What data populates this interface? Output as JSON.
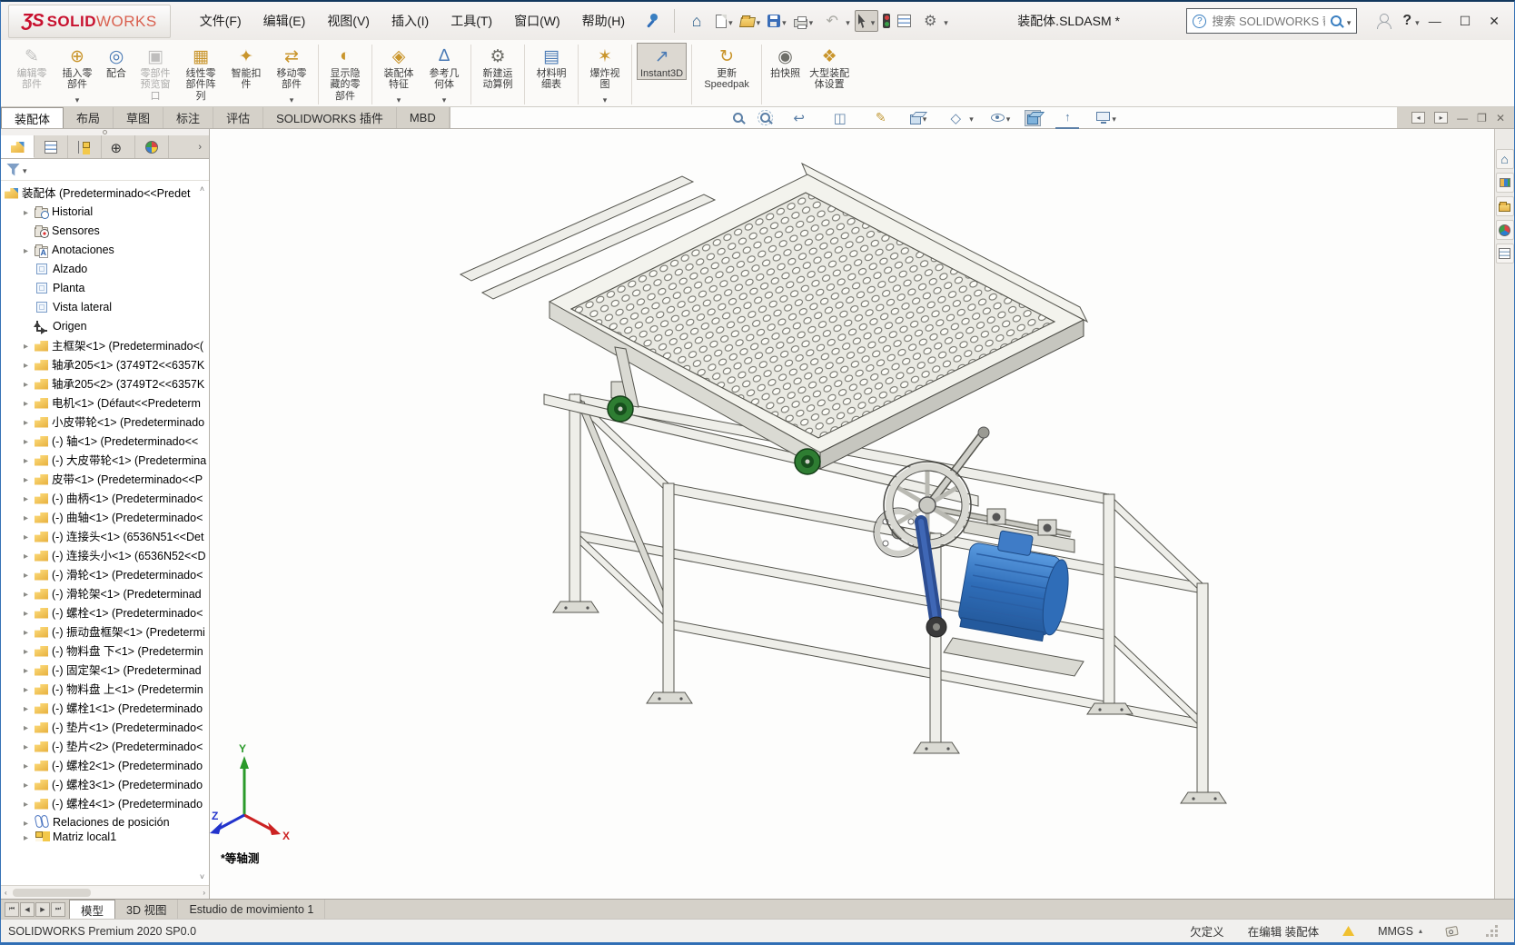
{
  "window": {
    "logo_mark": "ƷS",
    "logo_solid": "SOLID",
    "logo_works": "WORKS",
    "title": "装配体.SLDASM *",
    "search_placeholder": "搜索 SOLIDWORKS 帮助"
  },
  "menubar": {
    "items": [
      {
        "label": "文件(F)"
      },
      {
        "label": "编辑(E)"
      },
      {
        "label": "视图(V)"
      },
      {
        "label": "插入(I)"
      },
      {
        "label": "工具(T)"
      },
      {
        "label": "窗口(W)"
      },
      {
        "label": "帮助(H)"
      }
    ]
  },
  "toolbar": {
    "icons": [
      {
        "icon": "home",
        "dropdown": false
      },
      {
        "icon": "new-file",
        "dropdown": true
      },
      {
        "icon": "open-file",
        "dropdown": true
      },
      {
        "icon": "save",
        "dropdown": true
      },
      {
        "icon": "print",
        "dropdown": true
      },
      {
        "icon": "undo",
        "dropdown": true
      },
      {
        "icon": "select-cursor",
        "dropdown": true,
        "pressed": true
      },
      {
        "icon": "rebuild",
        "dropdown": false
      },
      {
        "icon": "display-options",
        "dropdown": false
      },
      {
        "icon": "settings",
        "dropdown": true
      }
    ]
  },
  "ribbon": {
    "buttons": [
      {
        "label": "编辑零部件",
        "icon": "edit-component",
        "glyph": "✎",
        "tone": "gray",
        "disabled": true
      },
      {
        "label": "插入零部件",
        "icon": "insert-component",
        "glyph": "⊕",
        "tone": "gold",
        "dropdown": true
      },
      {
        "label": "配合",
        "icon": "mate",
        "glyph": "◎",
        "tone": "blue"
      },
      {
        "label": "零部件预览窗口",
        "icon": "component-preview",
        "glyph": "▣",
        "tone": "gray",
        "disabled": true
      },
      {
        "label": "线性零部件阵列",
        "icon": "linear-pattern",
        "glyph": "▦",
        "tone": "gold",
        "dropdown": true
      },
      {
        "label": "智能扣件",
        "icon": "smart-fasteners",
        "glyph": "✦",
        "tone": "gold"
      },
      {
        "label": "移动零部件",
        "icon": "move-component",
        "glyph": "⇄",
        "tone": "gold",
        "dropdown": true,
        "sep_after": true
      },
      {
        "label": "显示隐藏的零部件",
        "icon": "show-hidden",
        "glyph": "◐",
        "tone": "gold",
        "sep_after": true
      },
      {
        "label": "装配体特征",
        "icon": "assembly-features",
        "glyph": "◈",
        "tone": "gold",
        "dropdown": true
      },
      {
        "label": "参考几何体",
        "icon": "reference-geometry",
        "glyph": "∆",
        "tone": "blue",
        "dropdown": true,
        "sep_after": true
      },
      {
        "label": "新建运动算例",
        "icon": "motion-study",
        "glyph": "⚙",
        "tone": "gray",
        "sep_after": true
      },
      {
        "label": "材料明细表",
        "icon": "bom",
        "glyph": "▤",
        "tone": "blue",
        "sep_after": true
      },
      {
        "label": "爆炸视图",
        "icon": "exploded-view",
        "glyph": "✶",
        "tone": "gold",
        "dropdown": true,
        "sep_after": true
      },
      {
        "label": "Instant3D",
        "icon": "instant3d",
        "glyph": "↗",
        "tone": "blue",
        "active": true,
        "style": "max-width:74px",
        "sep_after": true
      },
      {
        "label": "更新 Speedpak",
        "icon": "update-speedpak",
        "glyph": "↻",
        "tone": "gold",
        "style": "max-width:66px",
        "sep_after": true
      },
      {
        "label": "拍快照",
        "icon": "snapshot",
        "glyph": "◉",
        "tone": "gray"
      },
      {
        "label": "大型装配体设置",
        "icon": "large-assembly",
        "glyph": "❖",
        "tone": "gold",
        "style": "max-width:52px"
      }
    ]
  },
  "command_tabs": {
    "items": [
      {
        "label": "装配体",
        "active": true
      },
      {
        "label": "布局"
      },
      {
        "label": "草图"
      },
      {
        "label": "标注"
      },
      {
        "label": "评估"
      },
      {
        "label": "SOLIDWORKS 插件"
      },
      {
        "label": "MBD"
      }
    ]
  },
  "headsup": {
    "icons": [
      {
        "icon": "zoom-fit"
      },
      {
        "icon": "zoom-area"
      },
      {
        "icon": "previous-view"
      },
      {
        "icon": "section-view"
      },
      {
        "icon": "annotation-visibility"
      },
      {
        "icon": "view-orientation",
        "dropdown": true
      },
      {
        "icon": "display-style",
        "dropdown": true
      },
      {
        "icon": "hide-items",
        "dropdown": true
      },
      {
        "icon": "edit-appearance",
        "pressed": true
      },
      {
        "icon": "apply-scene"
      },
      {
        "icon": "view-settings",
        "dropdown": true
      }
    ]
  },
  "panel_tabs": {
    "items": [
      {
        "icon": "featuretree",
        "active": true
      },
      {
        "icon": "propertymgr"
      },
      {
        "icon": "configmgr"
      },
      {
        "icon": "dimxpert"
      },
      {
        "icon": "displaymgr"
      }
    ],
    "overflow": "›"
  },
  "feature_tree": {
    "root": "装配体 (Predeterminado<<Predet",
    "items": [
      {
        "icon": "history",
        "label": "Historial",
        "arrow": true
      },
      {
        "icon": "sensors",
        "label": "Sensores"
      },
      {
        "icon": "annotations",
        "label": "Anotaciones",
        "arrow": true
      },
      {
        "icon": "plane",
        "label": "Alzado"
      },
      {
        "icon": "plane",
        "label": "Planta"
      },
      {
        "icon": "plane",
        "label": "Vista lateral"
      },
      {
        "icon": "origin",
        "label": "Origen"
      },
      {
        "icon": "part",
        "label": "主框架<1> (Predeterminado<(",
        "arrow": true
      },
      {
        "icon": "part",
        "label": "轴承205<1> (3749T2<<6357K",
        "arrow": true
      },
      {
        "icon": "part",
        "label": "轴承205<2> (3749T2<<6357K",
        "arrow": true
      },
      {
        "icon": "part",
        "label": "电机<1> (Défaut<<Predeterm",
        "arrow": true
      },
      {
        "icon": "part",
        "label": "小皮带轮<1> (Predeterminado",
        "arrow": true
      },
      {
        "icon": "part",
        "label": "(-) 轴<1> (Predeterminado<<",
        "arrow": true
      },
      {
        "icon": "part",
        "label": "(-) 大皮带轮<1> (Predetermina",
        "arrow": true
      },
      {
        "icon": "part",
        "label": "皮带<1> (Predeterminado<<P",
        "arrow": true
      },
      {
        "icon": "part",
        "label": "(-) 曲柄<1> (Predeterminado<",
        "arrow": true
      },
      {
        "icon": "part",
        "label": "(-) 曲轴<1> (Predeterminado<",
        "arrow": true
      },
      {
        "icon": "part",
        "label": "(-) 连接头<1> (6536N51<<Det",
        "arrow": true
      },
      {
        "icon": "part",
        "label": "(-) 连接头小<1> (6536N52<<D",
        "arrow": true
      },
      {
        "icon": "part",
        "label": "(-) 滑轮<1> (Predeterminado<",
        "arrow": true
      },
      {
        "icon": "part",
        "label": "(-) 滑轮架<1> (Predeterminad",
        "arrow": true
      },
      {
        "icon": "part",
        "label": "(-) 螺栓<1> (Predeterminado<",
        "arrow": true
      },
      {
        "icon": "part",
        "label": "(-) 振动盘框架<1> (Predetermi",
        "arrow": true
      },
      {
        "icon": "part",
        "label": "(-) 物料盘 下<1> (Predetermin",
        "arrow": true
      },
      {
        "icon": "part",
        "label": "(-) 固定架<1> (Predeterminad",
        "arrow": true
      },
      {
        "icon": "part",
        "label": "(-) 物料盘 上<1> (Predetermin",
        "arrow": true
      },
      {
        "icon": "part",
        "label": "(-) 螺栓1<1> (Predeterminado",
        "arrow": true
      },
      {
        "icon": "part",
        "label": "(-) 垫片<1> (Predeterminado<",
        "arrow": true
      },
      {
        "icon": "part",
        "label": "(-) 垫片<2> (Predeterminado<",
        "arrow": true
      },
      {
        "icon": "part",
        "label": "(-) 螺栓2<1> (Predeterminado",
        "arrow": true
      },
      {
        "icon": "part",
        "label": "(-) 螺栓3<1> (Predeterminado",
        "arrow": true
      },
      {
        "icon": "part",
        "label": "(-) 螺栓4<1> (Predeterminado",
        "arrow": true
      },
      {
        "icon": "mates",
        "label": "Relaciones de posición",
        "arrow": true
      },
      {
        "icon": "pattern",
        "label": "Matriz local1",
        "arrow": true,
        "partial": true
      }
    ]
  },
  "task_pane": {
    "icons": [
      {
        "icon": "tp-home"
      },
      {
        "icon": "tp-library"
      },
      {
        "icon": "tp-explorer"
      },
      {
        "icon": "tp-appearance"
      },
      {
        "icon": "tp-props"
      }
    ]
  },
  "viewport": {
    "view_label": "*等轴测",
    "axis_x": "X",
    "axis_y": "Y",
    "axis_z": "Z"
  },
  "bottom_tabs": {
    "items": [
      {
        "label": "模型",
        "active": true
      },
      {
        "label": "3D 视图"
      },
      {
        "label": "Estudio de movimiento 1"
      }
    ]
  },
  "statusbar": {
    "left": "SOLIDWORKS Premium 2020 SP0.0",
    "defined_state": "欠定义",
    "editing_state": "在编辑 装配体",
    "units": "MMGS"
  }
}
